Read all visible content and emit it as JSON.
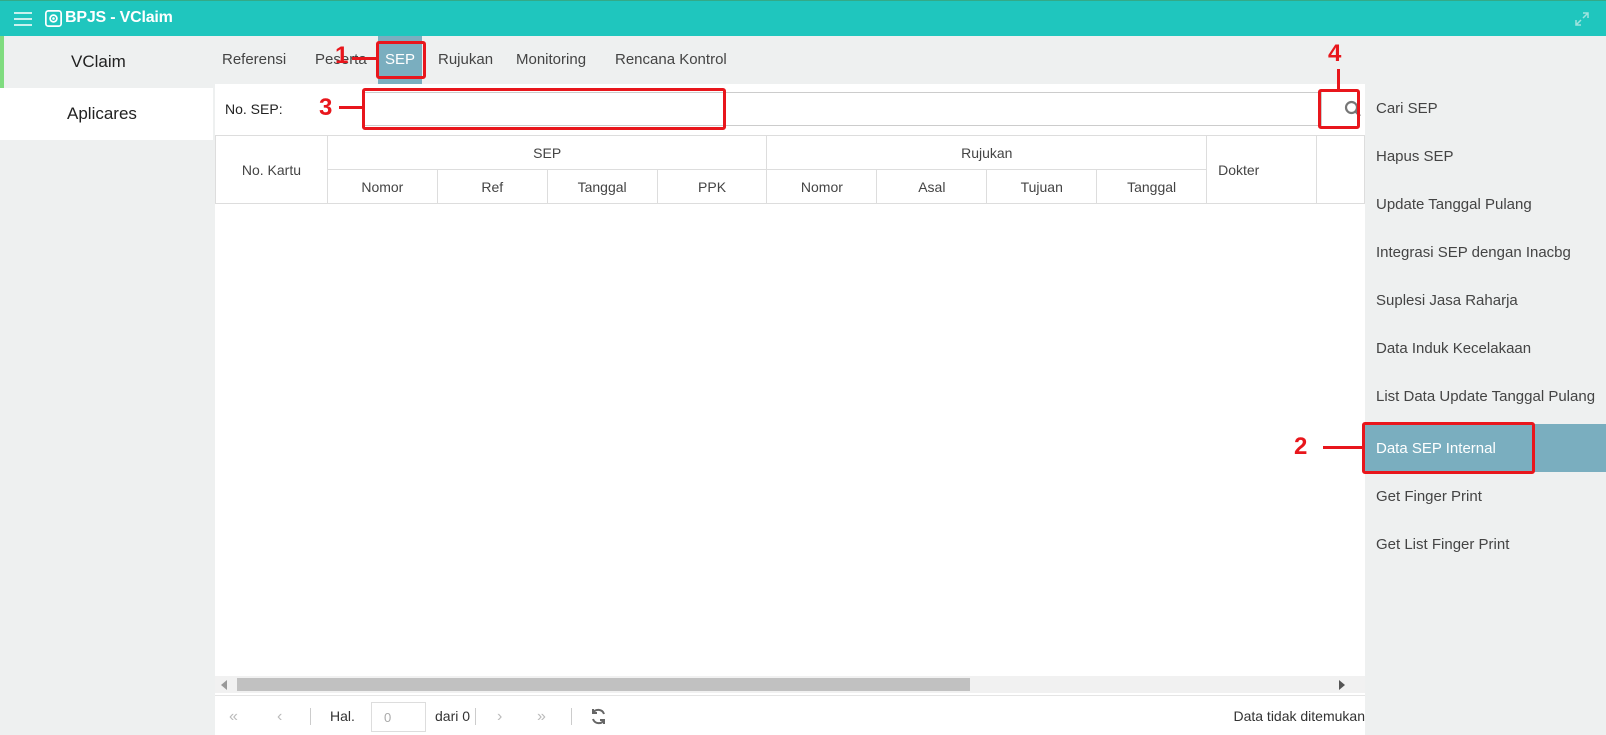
{
  "app": {
    "title": "BPJS - VClaim",
    "accent_color": "#1fc6be",
    "active_color": "#7aaebf"
  },
  "leftnav": {
    "items": [
      {
        "label": "VClaim"
      },
      {
        "label": "Aplicares"
      }
    ]
  },
  "tabs": [
    {
      "label": "Referensi"
    },
    {
      "label": "Peserta"
    },
    {
      "label": "SEP"
    },
    {
      "label": "Rujukan"
    },
    {
      "label": "Monitoring"
    },
    {
      "label": "Rencana Kontrol"
    }
  ],
  "sep_search": {
    "label": "No. SEP:",
    "value": ""
  },
  "table": {
    "headers": {
      "no_kartu": "No. Kartu",
      "sep": "SEP",
      "rujukan": "Rujukan",
      "dokter": "Dokter",
      "sep_sub": [
        "Nomor",
        "Ref",
        "Tanggal",
        "PPK"
      ],
      "rujukan_sub": [
        "Nomor",
        "Asal",
        "Tujuan",
        "Tanggal"
      ]
    }
  },
  "pager": {
    "hal_label": "Hal.",
    "page_value": "0",
    "dari_label": "dari 0",
    "status": "Data tidak ditemukan"
  },
  "right_menu": [
    {
      "label": "Cari SEP"
    },
    {
      "label": "Hapus SEP"
    },
    {
      "label": "Update Tanggal Pulang"
    },
    {
      "label": "Integrasi SEP dengan Inacbg"
    },
    {
      "label": "Suplesi Jasa Raharja"
    },
    {
      "label": "Data Induk Kecelakaan"
    },
    {
      "label": "List Data Update Tanggal Pulang"
    },
    {
      "label": "Data SEP Internal"
    },
    {
      "label": "Get Finger Print"
    },
    {
      "label": "Get List Finger Print"
    }
  ],
  "annotations": {
    "n1": "1",
    "n2": "2",
    "n3": "3",
    "n4": "4",
    "color": "#e8161c"
  }
}
